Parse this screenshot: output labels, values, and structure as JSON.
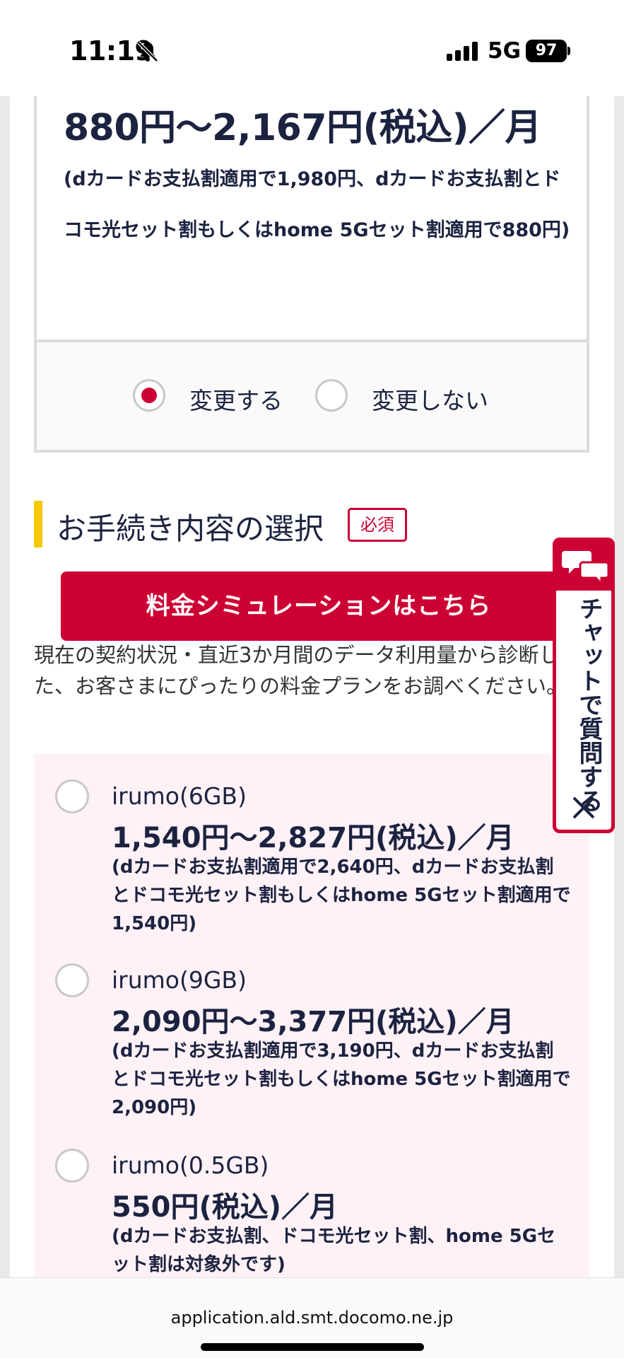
{
  "status_bar": {
    "time": "11:19",
    "network": "5G",
    "battery": "97"
  },
  "current_plan": {
    "price": "880円〜2,167円(税込)／月",
    "note": "(dカードお支払割適用で1,980円、dカードお支払割とドコモ光セット割もしくはhome 5Gセット割適用で880円)",
    "options": [
      "変更する",
      "変更しない"
    ],
    "selected": "変更する"
  },
  "section": {
    "title": "お手続き内容の選択",
    "required_badge": "必須"
  },
  "simulation_button": "料金シミュレーションはこちら",
  "description": "現在の契約状況・直近3か月間のデータ利用量から診断した、お客さまにぴったりの料金プランをお調べください。",
  "plans": [
    {
      "name": "irumo(6GB)",
      "price": "1,540円〜2,827円(税込)／月",
      "note": "(dカードお支払割適用で2,640円、dカードお支払割とドコモ光セット割もしくはhome 5Gセット割適用で1,540円)"
    },
    {
      "name": "irumo(9GB)",
      "price": "2,090円〜3,377円(税込)／月",
      "note": "(dカードお支払割適用で3,190円、dカードお支払割とドコモ光セット割もしくはhome 5Gセット割適用で2,090円)"
    },
    {
      "name": "irumo(0.5GB)",
      "price": "550円(税込)／月",
      "note": "(dカードお支払割、ドコモ光セット割、home 5Gセット割は対象外です)"
    }
  ],
  "chat": {
    "label": "チャットで質問する"
  },
  "browser": {
    "url": "application.ald.smt.docomo.ne.jp"
  },
  "colors": {
    "accent": "#cc0033",
    "section_bar": "#f5c800",
    "options_bg": "#fff2f7"
  }
}
